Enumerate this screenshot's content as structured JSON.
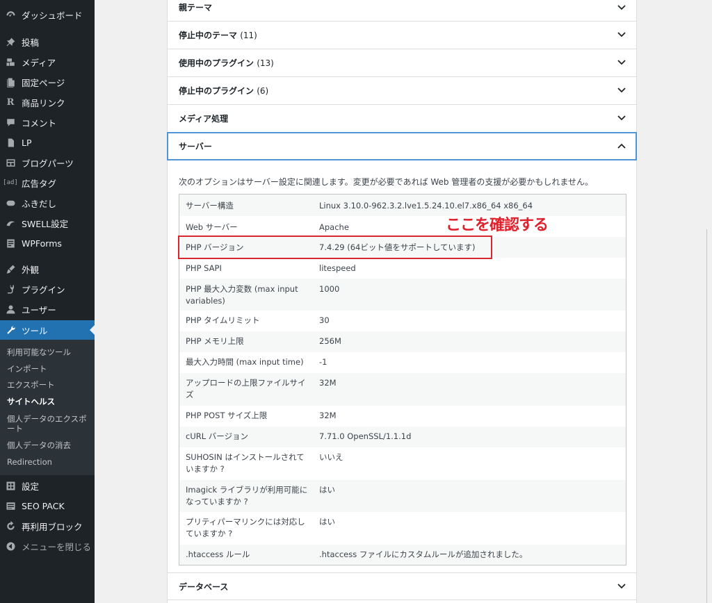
{
  "sidebar": {
    "items": [
      {
        "label": "ダッシュボード",
        "icon": "dashboard-icon"
      },
      {
        "label": "投稿",
        "icon": "pin-icon"
      },
      {
        "label": "メディア",
        "icon": "media-icon"
      },
      {
        "label": "固定ページ",
        "icon": "page-icon"
      },
      {
        "label": "商品リンク",
        "icon": "r-icon"
      },
      {
        "label": "コメント",
        "icon": "comment-icon"
      },
      {
        "label": "LP",
        "icon": "document-icon"
      },
      {
        "label": "ブログパーツ",
        "icon": "layout-icon"
      },
      {
        "label": "広告タグ",
        "icon": "ad-icon"
      },
      {
        "label": "ふきだし",
        "icon": "bubble-icon"
      },
      {
        "label": "SWELL設定",
        "icon": "swell-icon"
      },
      {
        "label": "WPForms",
        "icon": "form-icon"
      },
      {
        "label": "外観",
        "icon": "brush-icon"
      },
      {
        "label": "プラグイン",
        "icon": "plugin-icon"
      },
      {
        "label": "ユーザー",
        "icon": "user-icon"
      },
      {
        "label": "ツール",
        "icon": "wrench-icon"
      }
    ],
    "submenu": [
      {
        "label": "利用可能なツール"
      },
      {
        "label": "インポート"
      },
      {
        "label": "エクスポート"
      },
      {
        "label": "サイトヘルス"
      },
      {
        "label": "個人データのエクスポート"
      },
      {
        "label": "個人データの消去"
      },
      {
        "label": "Redirection"
      }
    ],
    "bottom_items": [
      {
        "label": "設定",
        "icon": "settings-icon"
      },
      {
        "label": "SEO PACK",
        "icon": "seo-icon"
      },
      {
        "label": "再利用ブロック",
        "icon": "reuse-icon"
      },
      {
        "label": "メニューを閉じる",
        "icon": "collapse-icon"
      }
    ]
  },
  "accordion": {
    "sections": [
      {
        "title": "親テーマ",
        "count": ""
      },
      {
        "title": "停止中のテーマ",
        "count": "(11)"
      },
      {
        "title": "使用中のプラグイン",
        "count": "(13)"
      },
      {
        "title": "停止中のプラグイン",
        "count": "(6)"
      },
      {
        "title": "メディア処理",
        "count": ""
      },
      {
        "title": "サーバー",
        "count": ""
      },
      {
        "title": "データベース",
        "count": ""
      }
    ]
  },
  "server": {
    "intro": "次のオプションはサーバー設定に関連します。変更が必要であれば Web 管理者の支援が必要かもしれません。",
    "rows": [
      {
        "label": "サーバー構造",
        "value": "Linux 3.10.0-962.3.2.lve1.5.24.10.el7.x86_64 x86_64"
      },
      {
        "label": "Web サーバー",
        "value": "Apache"
      },
      {
        "label": "PHP バージョン",
        "value": "7.4.29 (64ビット値をサポートしています)"
      },
      {
        "label": "PHP SAPI",
        "value": "litespeed"
      },
      {
        "label": "PHP 最大入力変数 (max input variables)",
        "value": "1000"
      },
      {
        "label": "PHP タイムリミット",
        "value": "30"
      },
      {
        "label": "PHP メモリ上限",
        "value": "256M"
      },
      {
        "label": "最大入力時間 (max input time)",
        "value": "-1"
      },
      {
        "label": "アップロードの上限ファイルサイズ",
        "value": "32M"
      },
      {
        "label": "PHP POST サイズ上限",
        "value": "32M"
      },
      {
        "label": "cURL バージョン",
        "value": "7.71.0 OpenSSL/1.1.1d"
      },
      {
        "label": "SUHOSIN はインストールされていますか ?",
        "value": "いいえ"
      },
      {
        "label": "Imagick ライブラリが利用可能になっていますか ?",
        "value": "はい"
      },
      {
        "label": "プリティパーマリンクには対応していますか ?",
        "value": "はい"
      },
      {
        "label": ".htaccess ルール",
        "value": ".htaccess ファイルにカスタムルールが追加されました。"
      }
    ]
  },
  "annotation": {
    "text": "ここを確認する",
    "color": "#e0202a"
  },
  "colors": {
    "sidebar_bg": "#1d2327",
    "active": "#2271b1",
    "highlight": "#d9262e"
  }
}
